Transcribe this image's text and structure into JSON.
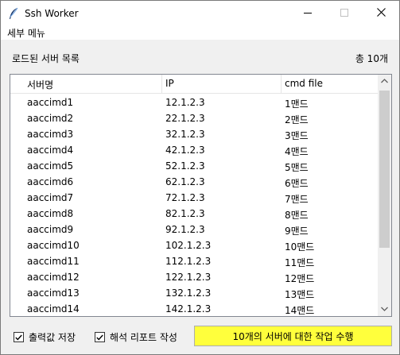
{
  "window": {
    "title": "Ssh Worker"
  },
  "menu": {
    "detail_menu": "세부 메뉴"
  },
  "header": {
    "list_label": "로드된 서버 목록",
    "total_count": "총 10개"
  },
  "table": {
    "columns": [
      "서버명",
      "IP",
      "cmd file"
    ],
    "rows": [
      [
        "aaccimd1",
        "12.1.2.3",
        "1맨드"
      ],
      [
        "aaccimd2",
        "22.1.2.3",
        "2맨드"
      ],
      [
        "aaccimd3",
        "32.1.2.3",
        "3맨드"
      ],
      [
        "aaccimd4",
        "42.1.2.3",
        "4맨드"
      ],
      [
        "aaccimd5",
        "52.1.2.3",
        "5맨드"
      ],
      [
        "aaccimd6",
        "62.1.2.3",
        "6맨드"
      ],
      [
        "aaccimd7",
        "72.1.2.3",
        "7맨드"
      ],
      [
        "aaccimd8",
        "82.1.2.3",
        "8맨드"
      ],
      [
        "aaccimd9",
        "92.1.2.3",
        "9맨드"
      ],
      [
        "aaccimd10",
        "102.1.2.3",
        "10맨드"
      ],
      [
        "aaccimd11",
        "112.1.2.3",
        "11맨드"
      ],
      [
        "aaccimd12",
        "122.1.2.3",
        "12맨드"
      ],
      [
        "aaccimd13",
        "132.1.2.3",
        "13맨드"
      ],
      [
        "aaccimd14",
        "142.1.2.3",
        "14맨드"
      ]
    ]
  },
  "footer": {
    "save_output_label": "출력값 저장",
    "save_output_checked": true,
    "report_label": "해석 리포트 작성",
    "report_checked": true,
    "run_button": "10개의 서버에 대한 작업 수행",
    "run_button_color": "#ffff3c"
  },
  "icons": {
    "app": "feather-icon",
    "minimize": "minimize-icon",
    "maximize": "maximize-icon",
    "close": "close-icon",
    "scroll_up": "chevron-up-icon",
    "scroll_down": "chevron-down-icon",
    "check": "check-icon"
  }
}
